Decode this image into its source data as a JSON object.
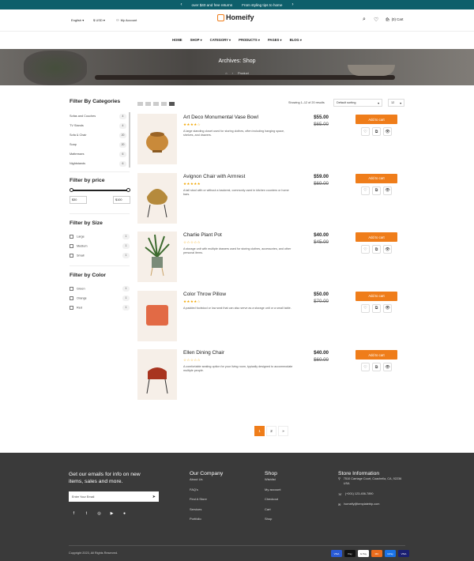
{
  "topbar": {
    "msg1": "over $40 and free returns",
    "msg2": "From styling tips to home"
  },
  "header": {
    "language": "English",
    "currency": "$ USD",
    "account": "My Account",
    "logo": "Homeify",
    "cart": "(0) Cart"
  },
  "nav": [
    {
      "label": "HOME",
      "caret": ""
    },
    {
      "label": "SHOP",
      "caret": "▾"
    },
    {
      "label": "CATEGORY",
      "caret": "▾"
    },
    {
      "label": "PRODUCTS",
      "caret": "▾"
    },
    {
      "label": "PAGES",
      "caret": "▾"
    },
    {
      "label": "BLOG",
      "caret": "▾"
    }
  ],
  "hero": {
    "title": "Archives: Shop",
    "crumb": "Product"
  },
  "sidebar": {
    "cat_title": "Filter By Categories",
    "categories": [
      {
        "label": "Sofas and Couches",
        "count": "4"
      },
      {
        "label": "TV Stands",
        "count": "4"
      },
      {
        "label": "Sofa & Chair",
        "count": "20"
      },
      {
        "label": "Soap",
        "count": "20"
      },
      {
        "label": "Mattresses",
        "count": "6"
      },
      {
        "label": "Nightstands",
        "count": "6"
      }
    ],
    "price_title": "Filter by price",
    "price_min": "$30",
    "price_max": "$100",
    "size_title": "Filter by Size",
    "sizes": [
      {
        "label": "Large",
        "count": "1"
      },
      {
        "label": "Medium",
        "count": "1"
      },
      {
        "label": "Small",
        "count": "1"
      }
    ],
    "color_title": "Filter by Color",
    "colors": [
      {
        "label": "Green",
        "count": "1"
      },
      {
        "label": "Orange",
        "count": "1"
      },
      {
        "label": "Red",
        "count": "1"
      }
    ]
  },
  "toolbar": {
    "showing": "Showing 1–12 of 20 results",
    "sort": "Default sorting",
    "perpage": "12"
  },
  "products": [
    {
      "name": "Art Deco Monumental Vase Bowl",
      "stars": "★★★★☆",
      "desc": "A large standing closet used for storing clothes, often including hanging space, shelves, and drawers.",
      "price": "$55.00",
      "old": "$65.00",
      "cart": "Add to cart"
    },
    {
      "name": "Avignon Chair with Armrest",
      "stars": "★★★★★",
      "desc": "A tall stool with or without a backrest, commonly used in kitchen counters or home bars.",
      "price": "$59.00",
      "old": "$69.00",
      "cart": "Add to cart"
    },
    {
      "name": "Charlie Plant Pot",
      "stars": "☆☆☆☆☆",
      "desc": "A storage unit with multiple drawers used for storing clothes, accessories, and other personal items.",
      "price": "$40.00",
      "old": "$45.00",
      "cart": "Add to cart"
    },
    {
      "name": "Color Throw Pillow",
      "stars": "★★★★☆",
      "desc": "A padded footstool or low seat that can also serve as a storage unit or a small table.",
      "price": "$50.00",
      "old": "$70.00",
      "cart": "Add to cart"
    },
    {
      "name": "Ellen Dining Chair",
      "stars": "☆☆☆☆☆",
      "desc": "A comfortable seating option for your living room, typically designed to accommodate multiple people.",
      "price": "$40.00",
      "old": "$60.00",
      "cart": "Add to cart"
    }
  ],
  "pagination": [
    "1",
    "2",
    "»"
  ],
  "footer": {
    "newsletter_title": "Get our emails for info on new items, sales and more.",
    "email_placeholder": "Enter Your Email",
    "company_title": "Our Company",
    "company_links": [
      "About Us",
      "FAQ's",
      "Find A Store",
      "Services",
      "Portfolio"
    ],
    "shop_title": "Shop",
    "shop_links": [
      "Wishlist",
      "My account",
      "Checkout",
      "Cart",
      "Shop"
    ],
    "store_title": "Store Information",
    "address": "7510 Carriage Court, Coachella, CA, 92236 USA",
    "phone": "(+001) 123-456-7890",
    "email": "homeify@templatetrip.com",
    "copyright": "Copyright 2023, All Rights Reserved.",
    "payments": [
      "VISA",
      "Pay",
      "G Pay",
      "MC",
      "GPay",
      "VISA"
    ]
  },
  "colors": {
    "accent": "#ef7d1a",
    "topbar": "#0e5f6b",
    "footer": "#3a3a3a"
  }
}
